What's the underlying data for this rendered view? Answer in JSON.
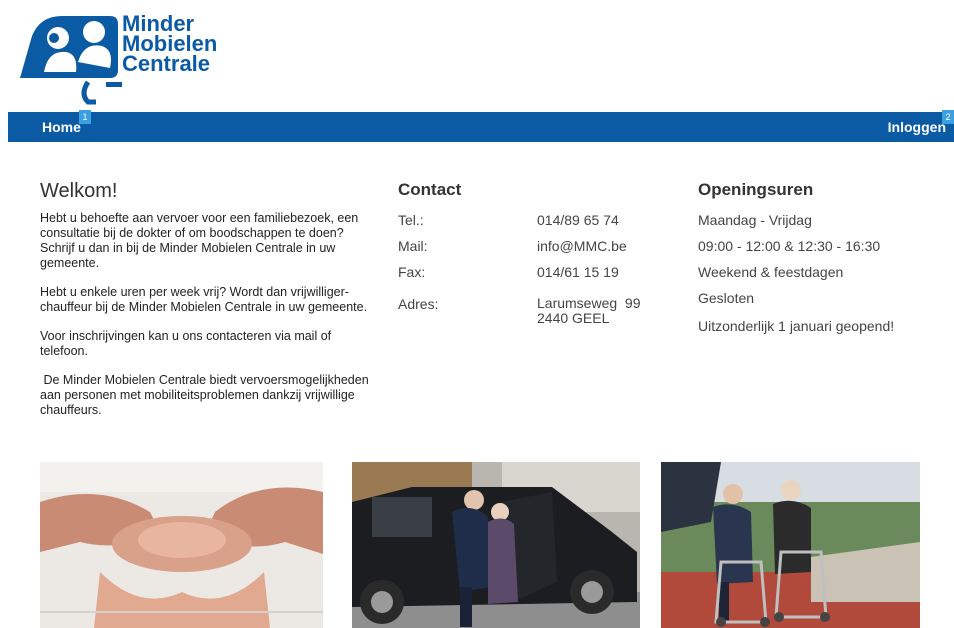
{
  "logo": {
    "line1": "Minder",
    "line2": "Mobielen",
    "line3": "Centrale"
  },
  "nav": {
    "home": "Home",
    "home_badge": "1",
    "login": "Inloggen",
    "login_badge": "2"
  },
  "welcome": {
    "title": "Welkom!",
    "paragraphs": [
      "Hebt u behoefte aan vervoer voor een familiebezoek, een consultatie bij de dokter of om boodschappen te doen? Schrijf u dan in bij de Minder Mobielen Centrale in uw gemeente.",
      "Hebt u enkele uren per week vrij? Wordt dan vrijwilliger-chauffeur bij de Minder Mobielen Centrale in uw gemeente.",
      "Voor inschrijvingen kan u ons contacteren via mail of telefoon.",
      " De Minder Mobielen Centrale biedt vervoersmogelijkheden aan personen met mobiliteitsproblemen dankzij vrijwillige chauffeurs."
    ]
  },
  "contact": {
    "title": "Contact",
    "tel_label": "Tel.:",
    "tel": "014/89 65 74",
    "mail_label": "Mail:",
    "mail": "info@MMC.be",
    "fax_label": "Fax:",
    "fax": "014/61 15 19",
    "address_label": "Adres:",
    "address_line1": "Larumseweg  99",
    "address_line2": "2440 GEEL"
  },
  "hours": {
    "title": "Openingsuren",
    "weekdays": "Maandag - Vrijdag",
    "weekday_hours": "09:00 - 12:00 & 12:30 - 16:30",
    "weekend": "Weekend & feestdagen",
    "weekend_status": "Gesloten",
    "exception": "Uitzonderlijk 1 januari geopend!"
  },
  "colors": {
    "brand_blue": "#0a5aa4",
    "badge_blue": "#3aa0e0"
  }
}
